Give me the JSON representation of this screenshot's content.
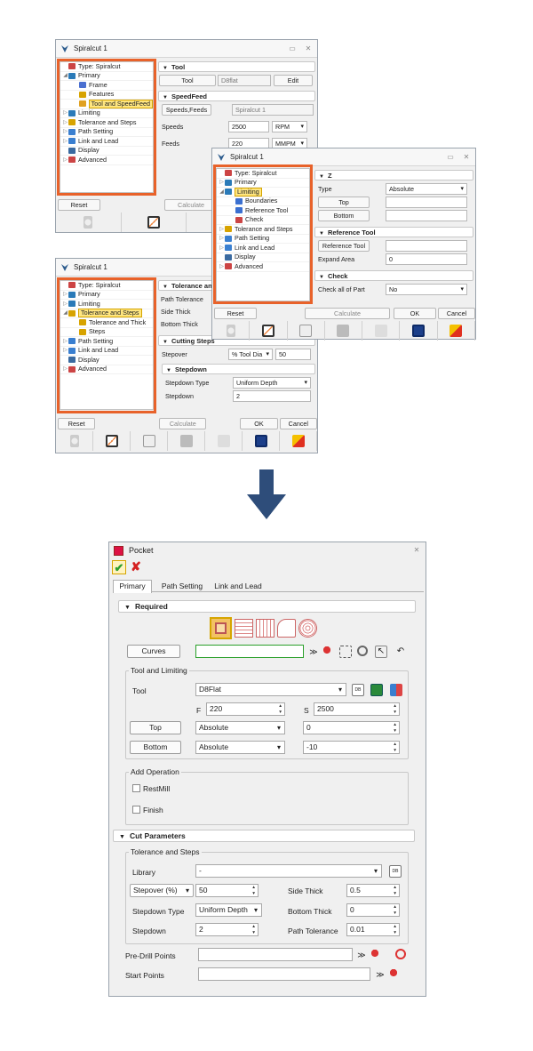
{
  "win1": {
    "title": "Spiralcut 1",
    "tree": [
      {
        "label": "Type: Spiralcut",
        "arr": "",
        "indent": 0,
        "icon": "#c44"
      },
      {
        "label": "Primary",
        "arr": "◢",
        "indent": 0,
        "icon": "#2a7ab8"
      },
      {
        "label": "Frame",
        "arr": "",
        "indent": 1,
        "icon": "#4a6fd0"
      },
      {
        "label": "Features",
        "arr": "",
        "indent": 1,
        "icon": "#d7a300"
      },
      {
        "label": "Tool and SpeedFeed",
        "arr": "",
        "indent": 1,
        "icon": "#e0a020",
        "selected": true
      },
      {
        "label": "Limiting",
        "arr": "▷",
        "indent": 0,
        "icon": "#2a7ab8"
      },
      {
        "label": "Tolerance and Steps",
        "arr": "▷",
        "indent": 0,
        "icon": "#d7a300"
      },
      {
        "label": "Path Setting",
        "arr": "▷",
        "indent": 0,
        "icon": "#3a7fd0"
      },
      {
        "label": "Link and Lead",
        "arr": "▷",
        "indent": 0,
        "icon": "#3a7fd0"
      },
      {
        "label": "Display",
        "arr": "",
        "indent": 0,
        "icon": "#3a6aa0"
      },
      {
        "label": "Advanced",
        "arr": "▷",
        "indent": 0,
        "icon": "#c44"
      }
    ],
    "sec_tool": "Tool",
    "tool_btn": "Tool",
    "tool_value": "D8flat",
    "edit_btn": "Edit",
    "sec_speedfeed": "SpeedFeed",
    "speeds_feeds_btn": "Speeds,Feeds",
    "speeds_feeds_value": "Spiralcut 1",
    "speeds_label": "Speeds",
    "speeds_value": "2500",
    "speeds_unit": "RPM",
    "feeds_label": "Feeds",
    "feeds_value": "220",
    "feeds_unit": "MMPM",
    "reset": "Reset",
    "calculate": "Calculate"
  },
  "win2": {
    "title": "Spiralcut 1",
    "tree": [
      {
        "label": "Type: Spiralcut",
        "arr": "",
        "indent": 0,
        "icon": "#c44"
      },
      {
        "label": "Primary",
        "arr": "▷",
        "indent": 0,
        "icon": "#2a7ab8"
      },
      {
        "label": "Limiting",
        "arr": "◢",
        "indent": 0,
        "icon": "#2a7ab8",
        "selected": true
      },
      {
        "label": "Boundaries",
        "arr": "",
        "indent": 1,
        "icon": "#3a6fd0"
      },
      {
        "label": "Reference Tool",
        "arr": "",
        "indent": 1,
        "icon": "#3a6fd0"
      },
      {
        "label": "Check",
        "arr": "",
        "indent": 1,
        "icon": "#c44"
      },
      {
        "label": "Tolerance and Steps",
        "arr": "▷",
        "indent": 0,
        "icon": "#d7a300"
      },
      {
        "label": "Path Setting",
        "arr": "▷",
        "indent": 0,
        "icon": "#3a7fd0"
      },
      {
        "label": "Link and Lead",
        "arr": "▷",
        "indent": 0,
        "icon": "#3a7fd0"
      },
      {
        "label": "Display",
        "arr": "",
        "indent": 0,
        "icon": "#3a6aa0"
      },
      {
        "label": "Advanced",
        "arr": "▷",
        "indent": 0,
        "icon": "#c44"
      }
    ],
    "sec_z": "Z",
    "type_label": "Type",
    "type_value": "Absolute",
    "top_btn": "Top",
    "bottom_btn": "Bottom",
    "sec_reftool": "Reference Tool",
    "reftool_btn": "Reference Tool",
    "expand_label": "Expand Area",
    "expand_value": "0",
    "sec_check": "Check",
    "checkall_label": "Check all of Part",
    "checkall_value": "No",
    "reset": "Reset",
    "calculate": "Calculate",
    "ok": "OK",
    "cancel": "Cancel"
  },
  "win3": {
    "title": "Spiralcut 1",
    "tree": [
      {
        "label": "Type: Spiralcut",
        "arr": "",
        "indent": 0,
        "icon": "#c44"
      },
      {
        "label": "Primary",
        "arr": "▷",
        "indent": 0,
        "icon": "#2a7ab8"
      },
      {
        "label": "Limiting",
        "arr": "▷",
        "indent": 0,
        "icon": "#2a7ab8"
      },
      {
        "label": "Tolerance and Steps",
        "arr": "◢",
        "indent": 0,
        "icon": "#d7a300",
        "selected": true
      },
      {
        "label": "Tolerance and Thick",
        "arr": "",
        "indent": 1,
        "icon": "#d7a300"
      },
      {
        "label": "Steps",
        "arr": "",
        "indent": 1,
        "icon": "#d7a300"
      },
      {
        "label": "Path Setting",
        "arr": "▷",
        "indent": 0,
        "icon": "#3a7fd0"
      },
      {
        "label": "Link and Lead",
        "arr": "▷",
        "indent": 0,
        "icon": "#3a7fd0"
      },
      {
        "label": "Display",
        "arr": "",
        "indent": 0,
        "icon": "#3a6aa0"
      },
      {
        "label": "Advanced",
        "arr": "▷",
        "indent": 0,
        "icon": "#c44"
      }
    ],
    "sec_toltick": "Tolerance and",
    "path_tol": "Path Tolerance",
    "side_thick": "Side Thick",
    "bottom_thick": "Bottom Thick",
    "sec_cutting": "Cutting Steps",
    "stepover_label": "Stepover",
    "stepover_mode": "% Tool Dia",
    "stepover_value": "50",
    "sec_stepdown": "Stepdown",
    "stepdown_type_label": "Stepdown Type",
    "stepdown_type_value": "Uniform Depth",
    "stepdown_label": "Stepdown",
    "stepdown_value": "2",
    "reset": "Reset",
    "calculate": "Calculate",
    "ok": "OK",
    "cancel": "Cancel"
  },
  "pocket": {
    "title": "Pocket",
    "tabs": [
      "Primary",
      "Path Setting",
      "Link and Lead"
    ],
    "sec_required": "Required",
    "curves_btn": "Curves",
    "grp_tool": "Tool and Limiting",
    "tool_label": "Tool",
    "tool_value": "D8Flat",
    "f_label": "F",
    "f_value": "220",
    "s_label": "S",
    "s_value": "2500",
    "top_btn": "Top",
    "top_mode": "Absolute",
    "top_value": "0",
    "bottom_btn": "Bottom",
    "bottom_mode": "Absolute",
    "bottom_value": "-10",
    "grp_addop": "Add Operation",
    "restmill": "RestMill",
    "finish": "Finish",
    "sec_cut": "Cut Parameters",
    "grp_tol": "Tolerance and Steps",
    "library_label": "Library",
    "library_value": "-",
    "stepover_mode": "Stepover (%)",
    "stepover_value": "50",
    "side_thick_label": "Side Thick",
    "side_thick_value": "0.5",
    "stepdown_type_label": "Stepdown Type",
    "stepdown_type_value": "Uniform Depth",
    "bottom_thick_label": "Bottom Thick",
    "bottom_thick_value": "0",
    "stepdown_label": "Stepdown",
    "stepdown_value": "2",
    "path_tol_label": "Path Tolerance",
    "path_tol_value": "0.01",
    "predrill_label": "Pre-Drill Points",
    "start_label": "Start Points"
  },
  "colors": {
    "highlight": "#e8622a",
    "arrow": "#2e4d7a",
    "ok_green": "#2e9e2e",
    "cancel_red": "#d42020"
  }
}
